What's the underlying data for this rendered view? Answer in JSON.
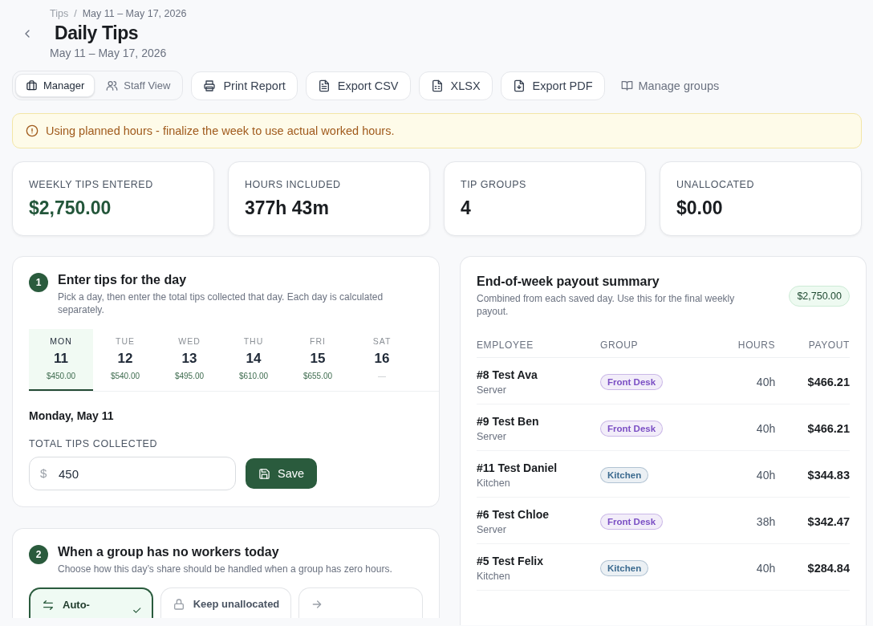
{
  "breadcrumb": [
    {
      "label": "Tips"
    },
    {
      "label": "May 11 – May 17, 2026"
    }
  ],
  "breadcrumb_separator": "/",
  "title": "Daily Tips",
  "subtitle": "May 11 – May 17, 2026",
  "view_toggle": [
    {
      "label": "Manager",
      "kind": "briefcase",
      "selected": true
    },
    {
      "label": "Staff View",
      "kind": "users",
      "selected": false
    }
  ],
  "actions": [
    {
      "label": "Print Report",
      "kind": "printer"
    },
    {
      "label": "Export CSV",
      "kind": "document"
    },
    {
      "label": "XLSX",
      "kind": "sheet"
    },
    {
      "label": "Export PDF",
      "kind": "download"
    }
  ],
  "manage_link": "Manage groups",
  "alert": "Using planned hours - finalize the week to use actual worked hours.",
  "stats": [
    {
      "label": "WEEKLY TIPS ENTERED",
      "value": "$2,750.00",
      "kind": "money"
    },
    {
      "label": "HOURS INCLUDED",
      "value": "377h 43m",
      "kind": "plain"
    },
    {
      "label": "TIP GROUPS",
      "value": "4",
      "kind": "plain"
    },
    {
      "label": "UNALLOCATED",
      "value": "$0.00",
      "kind": "plain"
    }
  ],
  "step1": {
    "number": "1",
    "title": "Enter tips for the day",
    "description": "Pick a day, then enter the total tips collected that day. Each day is calculated separately.",
    "days": [
      {
        "weekday": "MON",
        "date": "11",
        "amount": "$450.00",
        "selected": true
      },
      {
        "weekday": "TUE",
        "date": "12",
        "amount": "$540.00",
        "selected": false
      },
      {
        "weekday": "WED",
        "date": "13",
        "amount": "$495.00",
        "selected": false
      },
      {
        "weekday": "THU",
        "date": "14",
        "amount": "$610.00",
        "selected": false
      },
      {
        "weekday": "FRI",
        "date": "15",
        "amount": "$655.00",
        "selected": false
      },
      {
        "weekday": "SAT",
        "date": "16",
        "amount": "—",
        "selected": false
      }
    ],
    "day_heading": "Monday, May 11",
    "field_label": "TOTAL TIPS COLLECTED",
    "currency": "$",
    "value": "450",
    "save": "Save"
  },
  "step2": {
    "number": "2",
    "title": "When a group has no workers today",
    "description": "Choose how this day’s share should be handled when a group has zero hours.",
    "options": [
      {
        "label": "Auto-",
        "kind": "swap",
        "selected": true
      },
      {
        "label": "Keep unallocated",
        "kind": "lock",
        "selected": false
      },
      {
        "kind": "arrow",
        "selected": false
      }
    ]
  },
  "summary": {
    "title": "End-of-week payout summary",
    "description": "Combined from each saved day. Use this for the final weekly payout.",
    "total": "$2,750.00",
    "columns": [
      "EMPLOYEE",
      "GROUP",
      "HOURS",
      "PAYOUT"
    ],
    "rows": [
      {
        "name": "#8 Test Ava",
        "role": "Server",
        "group": "Front Desk",
        "color": "#7b4fc4",
        "hours": "40h",
        "payout": "$466.21"
      },
      {
        "name": "#9 Test Ben",
        "role": "Server",
        "group": "Front Desk",
        "color": "#7b4fc4",
        "hours": "40h",
        "payout": "$466.21"
      },
      {
        "name": "#11 Test Daniel",
        "role": "Kitchen",
        "group": "Kitchen",
        "color": "#3b6a8f",
        "hours": "40h",
        "payout": "$344.83"
      },
      {
        "name": "#6 Test Chloe",
        "role": "Server",
        "group": "Front Desk",
        "color": "#7b4fc4",
        "hours": "38h",
        "payout": "$342.47"
      },
      {
        "name": "#5 Test Felix",
        "role": "Kitchen",
        "group": "Kitchen",
        "color": "#3b6a8f",
        "hours": "40h",
        "payout": "$284.84"
      }
    ]
  }
}
